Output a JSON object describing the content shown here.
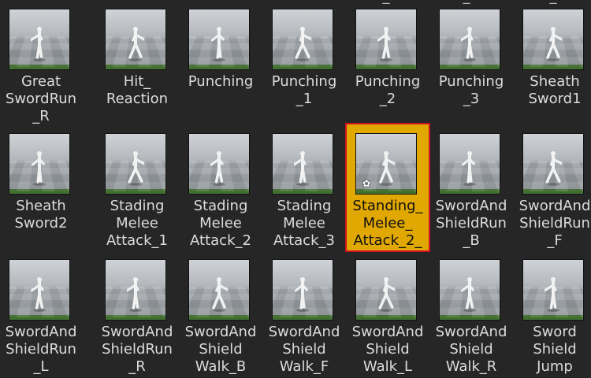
{
  "clip_fragments": [
    "_",
    "_",
    "_"
  ],
  "assets": [
    {
      "label": "Great\nSwordRun\n_R",
      "selected": false
    },
    {
      "label": "Hit_\nReaction",
      "selected": false
    },
    {
      "label": "Punching",
      "selected": false
    },
    {
      "label": "Punching\n_1",
      "selected": false
    },
    {
      "label": "Punching\n_2",
      "selected": false
    },
    {
      "label": "Punching\n_3",
      "selected": false
    },
    {
      "label": "Sheath\nSword1",
      "selected": false
    },
    {
      "label": "Sheath\nSword2",
      "selected": false
    },
    {
      "label": "Stading\nMelee\nAttack_1",
      "selected": false
    },
    {
      "label": "Stading\nMelee\nAttack_2",
      "selected": false
    },
    {
      "label": "Stading\nMelee\nAttack_3",
      "selected": false
    },
    {
      "label": "Standing_\nMelee_\nAttack_2_",
      "selected": true
    },
    {
      "label": "SwordAnd\nShieldRun\n_B",
      "selected": false
    },
    {
      "label": "SwordAnd\nShieldRun\n_F",
      "selected": false
    },
    {
      "label": "SwordAnd\nShieldRun\n_L",
      "selected": false
    },
    {
      "label": "SwordAnd\nShieldRun\n_R",
      "selected": false
    },
    {
      "label": "SwordAnd\nShield\nWalk_B",
      "selected": false
    },
    {
      "label": "SwordAnd\nShield\nWalk_F",
      "selected": false
    },
    {
      "label": "SwordAnd\nShield\nWalk_L",
      "selected": false
    },
    {
      "label": "SwordAnd\nShield\nWalk_R",
      "selected": false
    },
    {
      "label": "Sword\nShield\nJump",
      "selected": false
    }
  ],
  "icons": {
    "animation_badge": "gear-icon",
    "thumbnail_subject": "character-icon"
  },
  "colors": {
    "background": "#262626",
    "selected_fill": "#e0a800",
    "selected_border": "#d01020",
    "label_text": "#dcdcdc",
    "ground": "#3f6f2d"
  }
}
